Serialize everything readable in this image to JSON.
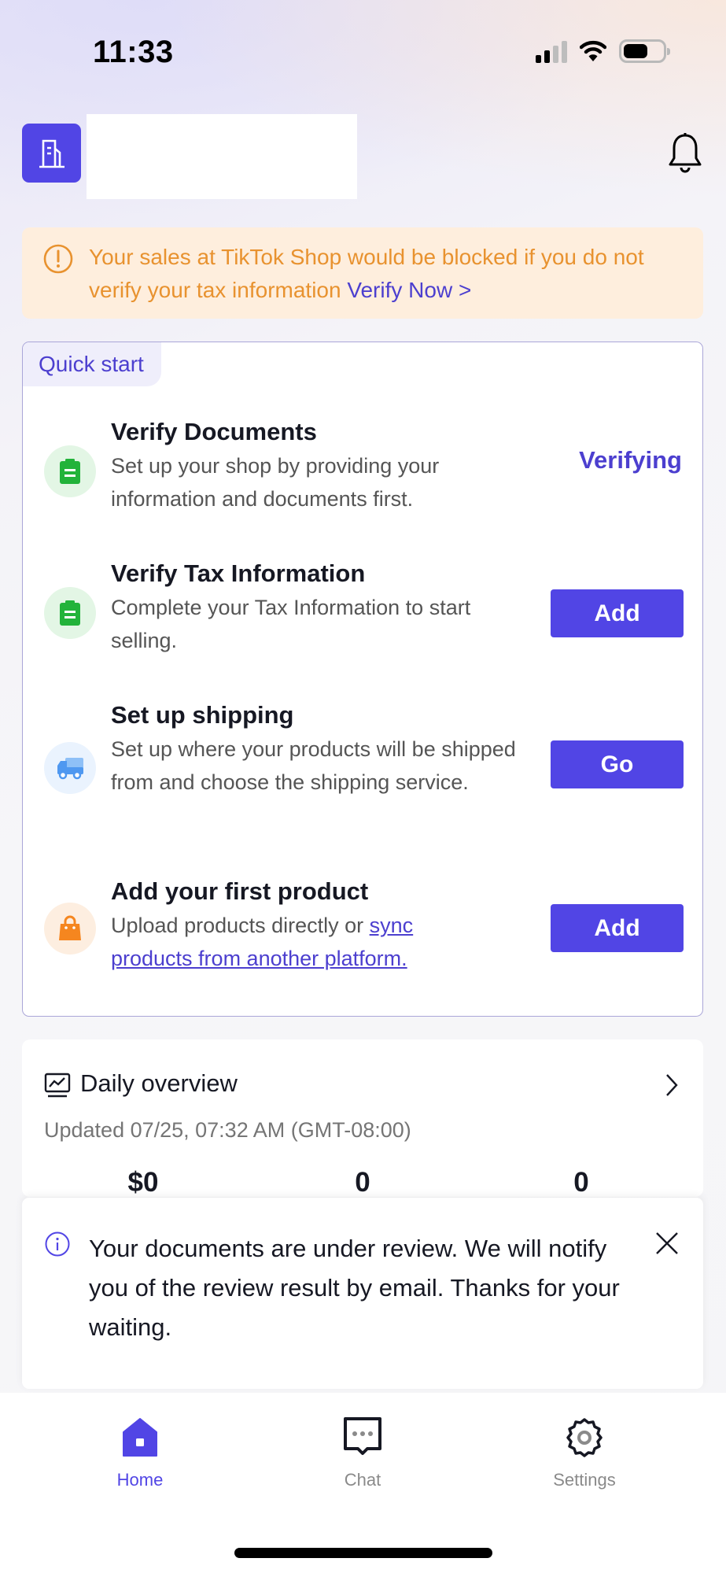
{
  "status_bar": {
    "time": "11:33",
    "signal_icon": "cellular-signal-icon",
    "wifi_icon": "wifi-icon",
    "battery_icon": "battery-icon"
  },
  "header": {
    "logo_icon": "building-icon",
    "shop_name": "",
    "notification_icon": "bell-icon"
  },
  "warning_banner": {
    "icon": "exclamation-circle-icon",
    "message": "Your sales at TikTok Shop would be blocked if you do not verify your tax information ",
    "link_label": "Verify Now >",
    "text_color": "#e8922f",
    "background": "#feeedd"
  },
  "quick_start": {
    "label": "Quick start",
    "tasks": [
      {
        "icon": "clipboard-icon",
        "title": "Verify Documents",
        "description": "Set up your shop by providing your information and documents first.",
        "status": "Verifying"
      },
      {
        "icon": "clipboard-icon",
        "title": "Verify Tax Information",
        "description": "Complete your Tax Information to start selling.",
        "button": "Add"
      },
      {
        "icon": "truck-icon",
        "title": "Set up shipping",
        "description": "Set up where your products will be shipped from and choose the shipping service.",
        "button": "Go"
      },
      {
        "icon": "shopping-bag-icon",
        "title": "Add your first product",
        "description_prefix": "Upload products directly or ",
        "description_link": "sync products from another platform.",
        "button": "Add"
      }
    ]
  },
  "daily_overview": {
    "icon": "chart-monitor-icon",
    "title": "Daily overview",
    "updated": "Updated 07/25, 07:32 AM (GMT-08:00)",
    "metrics": [
      "$0",
      "0",
      "0"
    ]
  },
  "toast": {
    "icon": "info-circle-icon",
    "message": "Your documents are under review. We will notify you of the review result by email. Thanks for your waiting.",
    "close_icon": "close-icon"
  },
  "tab_bar": {
    "tabs": [
      {
        "label": "Home",
        "icon": "home-icon",
        "active": true
      },
      {
        "label": "Chat",
        "icon": "chat-icon",
        "active": false
      },
      {
        "label": "Settings",
        "icon": "gear-icon",
        "active": false
      }
    ]
  },
  "colors": {
    "accent": "#5145e5",
    "accent_text": "#4c3fcf",
    "warning": "#e8922f",
    "success_icon": "#22b33a",
    "shipping_icon": "#4f98f0",
    "product_icon": "#f5861f"
  }
}
